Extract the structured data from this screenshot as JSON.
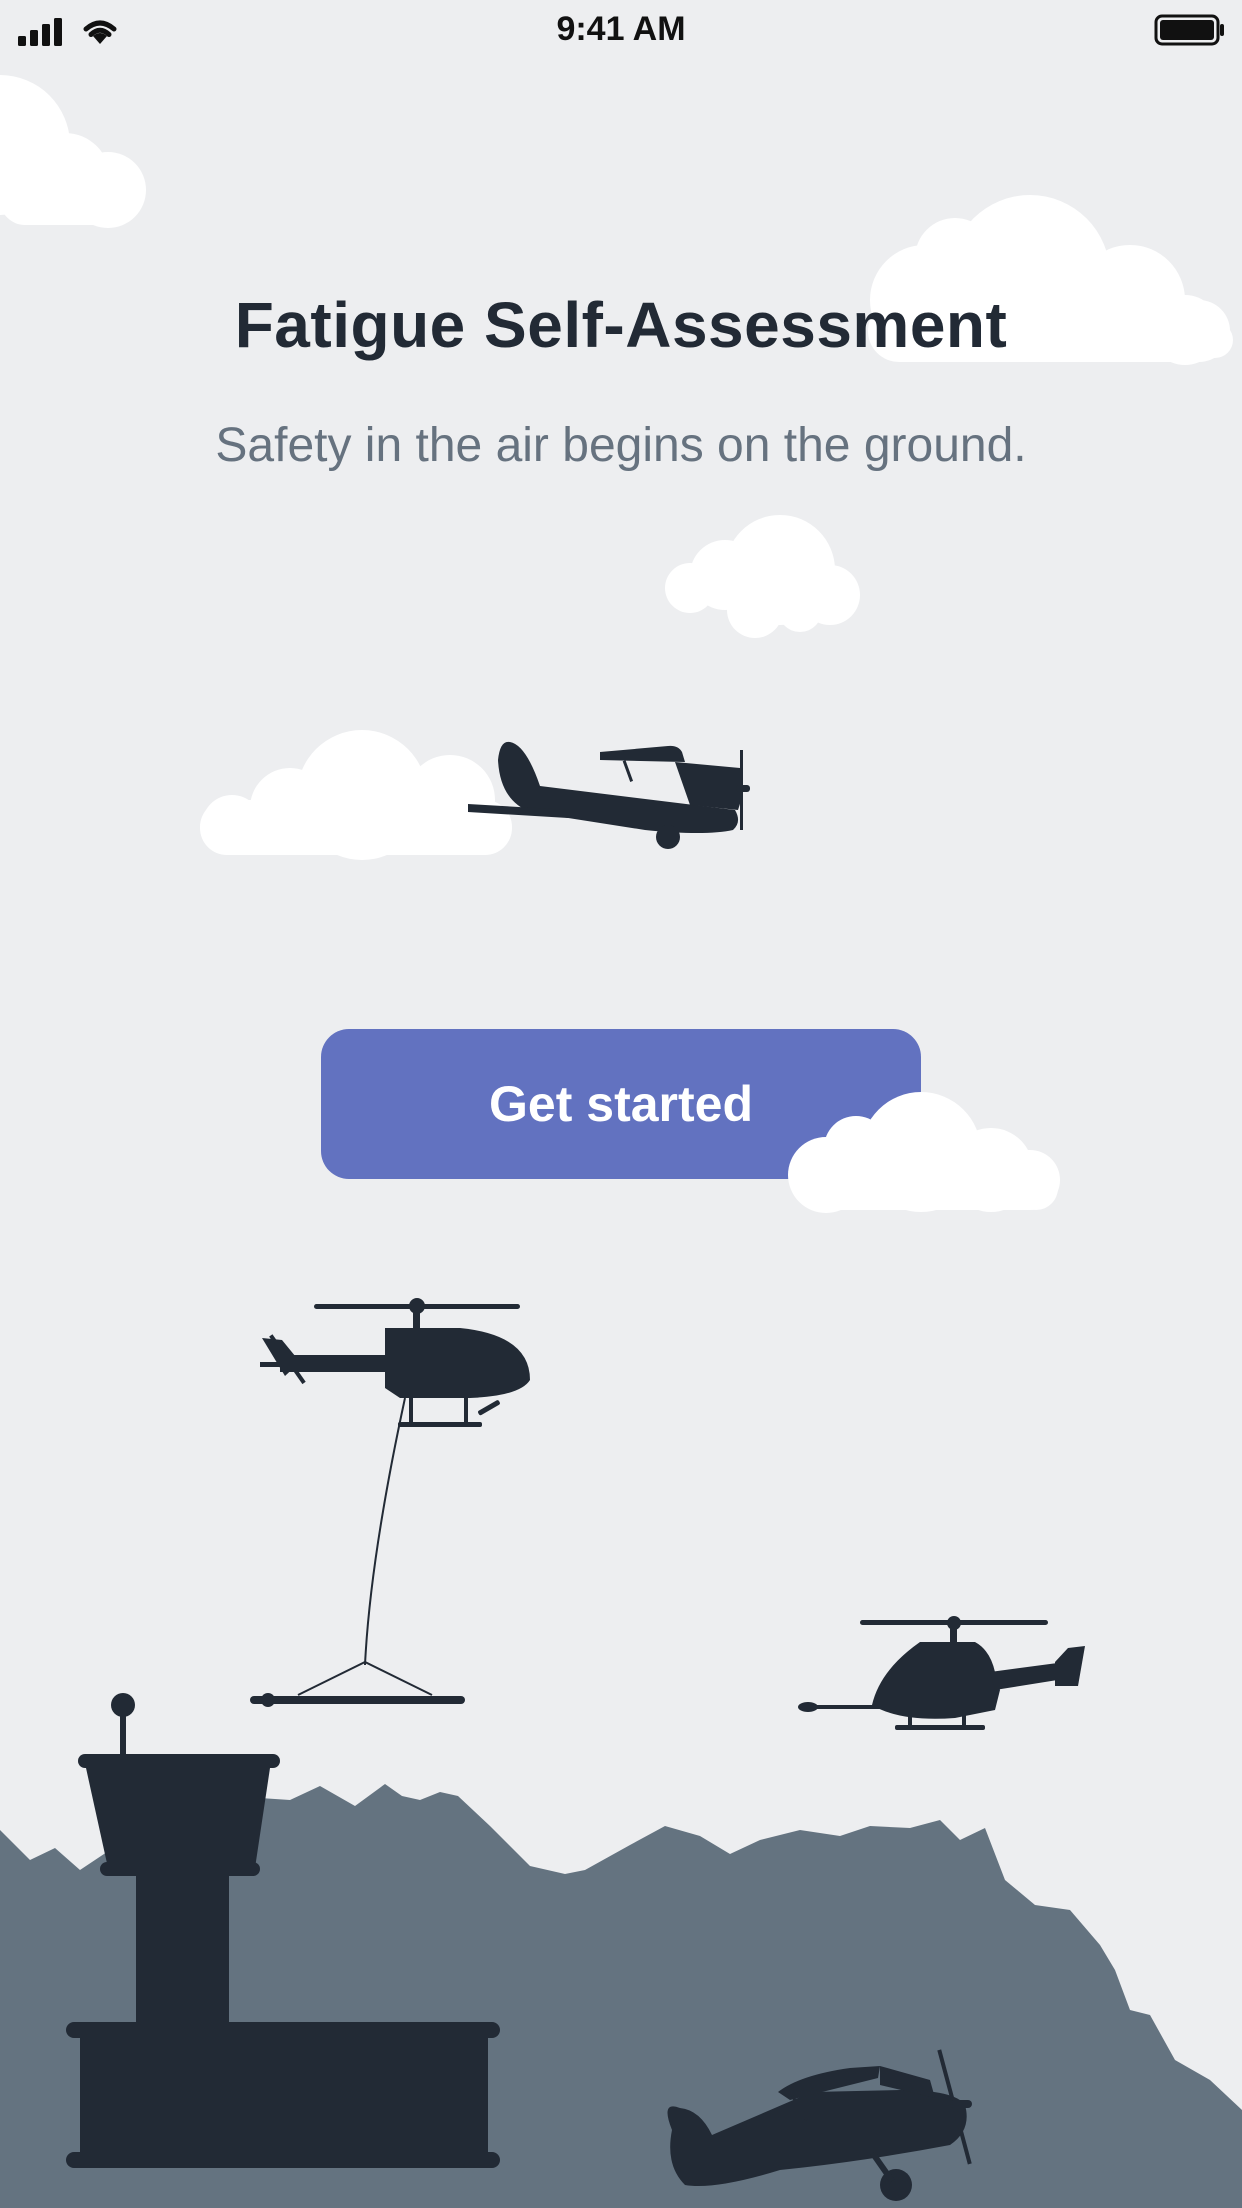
{
  "status_bar": {
    "time": "9:41 AM"
  },
  "header": {
    "title": "Fatigue Self-Assessment",
    "subtitle": "Safety in the air begins on the ground."
  },
  "actions": {
    "get_started_label": "Get started"
  },
  "colors": {
    "background": "#edeef0",
    "title": "#222a35",
    "subtitle": "#66727f",
    "button": "#6272c0",
    "silhouette": "#222a35",
    "mountains": "#647380",
    "cloud": "#ffffff"
  },
  "icons": [
    "signal-icon",
    "wifi-icon",
    "battery-icon"
  ]
}
